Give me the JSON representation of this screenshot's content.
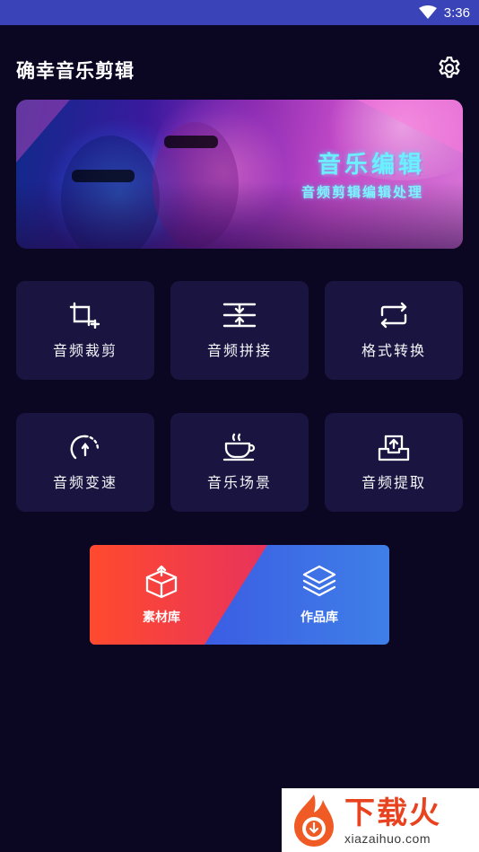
{
  "status_bar": {
    "time": "3:36"
  },
  "header": {
    "title": "确幸音乐剪辑",
    "settings_icon": "gear-icon"
  },
  "banner": {
    "title": "音乐编辑",
    "subtitle": "音频剪辑编辑处理"
  },
  "tools": [
    {
      "label": "音频裁剪",
      "icon": "crop-icon"
    },
    {
      "label": "音频拼接",
      "icon": "merge-icon"
    },
    {
      "label": "格式转换",
      "icon": "convert-icon"
    },
    {
      "label": "音频变速",
      "icon": "speedometer-icon"
    },
    {
      "label": "音乐场景",
      "icon": "coffee-cup-icon"
    },
    {
      "label": "音频提取",
      "icon": "extract-icon"
    }
  ],
  "library": {
    "material_label": "素材库",
    "works_label": "作品库",
    "colors": {
      "left": "#ff4a2e",
      "right": "#3a4fe6"
    }
  },
  "watermark": {
    "cn": "下载火",
    "en": "xiazaihuo.com"
  },
  "colors": {
    "background": "#0b0621",
    "tile": "#1a1440",
    "status_bar": "#3a43b8",
    "banner_text": "#6cf0ff"
  }
}
